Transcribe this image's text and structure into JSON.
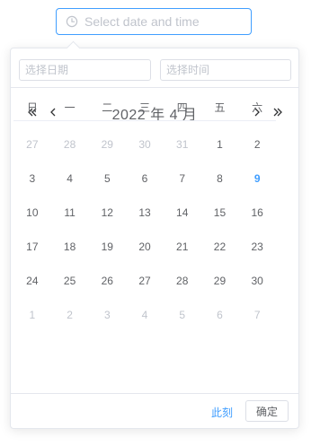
{
  "picker": {
    "placeholder": "Select date and time",
    "icon": "clock-icon"
  },
  "panel": {
    "date_placeholder": "选择日期",
    "time_placeholder": "选择时间",
    "nav": {
      "prev_year_icon": "double-chevron-left-icon",
      "prev_month_icon": "chevron-left-icon",
      "next_month_icon": "chevron-right-icon",
      "next_year_icon": "double-chevron-right-icon"
    },
    "title": {
      "year": "2022 年",
      "month": "4 月"
    },
    "weekdays": [
      "日",
      "一",
      "二",
      "三",
      "四",
      "五",
      "六"
    ],
    "weeks": [
      [
        {
          "d": "27",
          "m": true
        },
        {
          "d": "28",
          "m": true
        },
        {
          "d": "29",
          "m": true
        },
        {
          "d": "30",
          "m": true
        },
        {
          "d": "31",
          "m": true
        },
        {
          "d": "1"
        },
        {
          "d": "2"
        }
      ],
      [
        {
          "d": "3"
        },
        {
          "d": "4"
        },
        {
          "d": "5"
        },
        {
          "d": "6"
        },
        {
          "d": "7"
        },
        {
          "d": "8"
        },
        {
          "d": "9",
          "today": true
        }
      ],
      [
        {
          "d": "10"
        },
        {
          "d": "11"
        },
        {
          "d": "12"
        },
        {
          "d": "13"
        },
        {
          "d": "14"
        },
        {
          "d": "15"
        },
        {
          "d": "16"
        }
      ],
      [
        {
          "d": "17"
        },
        {
          "d": "18"
        },
        {
          "d": "19"
        },
        {
          "d": "20"
        },
        {
          "d": "21"
        },
        {
          "d": "22"
        },
        {
          "d": "23"
        }
      ],
      [
        {
          "d": "24"
        },
        {
          "d": "25"
        },
        {
          "d": "26"
        },
        {
          "d": "27"
        },
        {
          "d": "28"
        },
        {
          "d": "29"
        },
        {
          "d": "30"
        }
      ],
      [
        {
          "d": "1",
          "m": true
        },
        {
          "d": "2",
          "m": true
        },
        {
          "d": "3",
          "m": true
        },
        {
          "d": "4",
          "m": true
        },
        {
          "d": "5",
          "m": true
        },
        {
          "d": "6",
          "m": true
        },
        {
          "d": "7",
          "m": true
        }
      ]
    ],
    "footer": {
      "now_label": "此刻",
      "ok_label": "确定"
    }
  },
  "colors": {
    "accent": "#409eff",
    "text": "#606266",
    "muted": "#c0c4cc",
    "border": "#e4e7ed"
  }
}
